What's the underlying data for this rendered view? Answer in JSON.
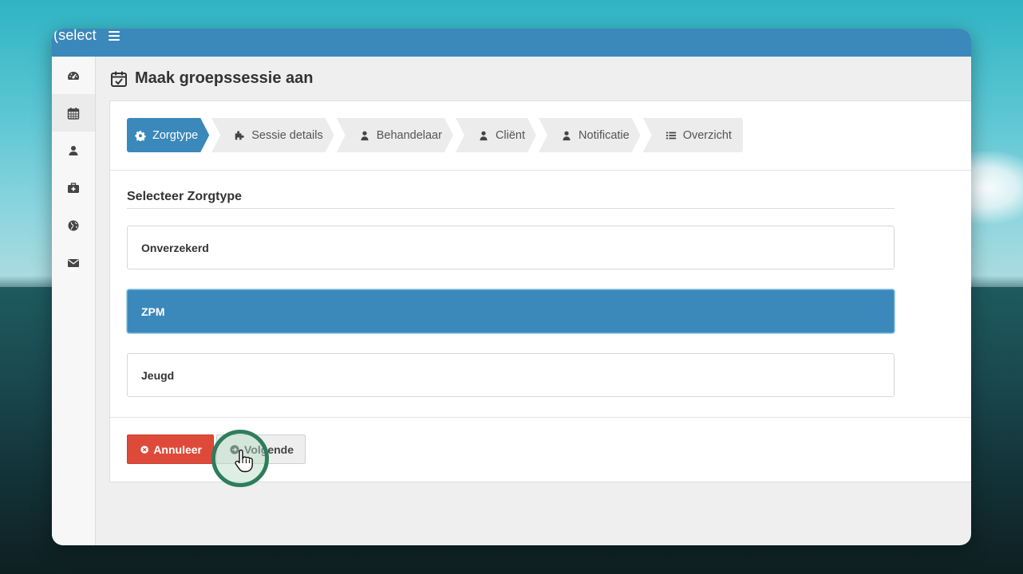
{
  "app": {
    "brand": "(select",
    "menu_icon": "hamburger-icon",
    "accent_color": "#3b88bb",
    "danger_color": "#de4a39"
  },
  "sidebar": {
    "items": [
      {
        "icon": "dashboard-icon",
        "active": false
      },
      {
        "icon": "calendar-icon",
        "active": true
      },
      {
        "icon": "user-icon",
        "active": false
      },
      {
        "icon": "medkit-icon",
        "active": false
      },
      {
        "icon": "globe-icon",
        "active": false
      },
      {
        "icon": "envelope-icon",
        "active": false
      }
    ]
  },
  "page": {
    "title": "Maak groepssessie aan",
    "title_icon": "calendar-check-icon"
  },
  "wizard": {
    "steps": [
      {
        "label": "Zorgtype",
        "icon": "gear-icon",
        "active": true
      },
      {
        "label": "Sessie details",
        "icon": "puzzle-icon",
        "active": false
      },
      {
        "label": "Behandelaar",
        "icon": "user-icon",
        "active": false
      },
      {
        "label": "Cliënt",
        "icon": "user-icon",
        "active": false
      },
      {
        "label": "Notificatie",
        "icon": "user-icon",
        "active": false
      },
      {
        "label": "Overzicht",
        "icon": "list-icon",
        "active": false
      }
    ]
  },
  "form": {
    "section_title": "Selecteer Zorgtype",
    "options": [
      {
        "label": "Onverzekerd",
        "selected": false
      },
      {
        "label": "ZPM",
        "selected": true
      },
      {
        "label": "Jeugd",
        "selected": false
      }
    ]
  },
  "actions": {
    "cancel_label": "Annuleer",
    "cancel_icon": "times-circle-icon",
    "next_label": "Volgende",
    "next_icon": "arrow-circle-right-icon"
  }
}
